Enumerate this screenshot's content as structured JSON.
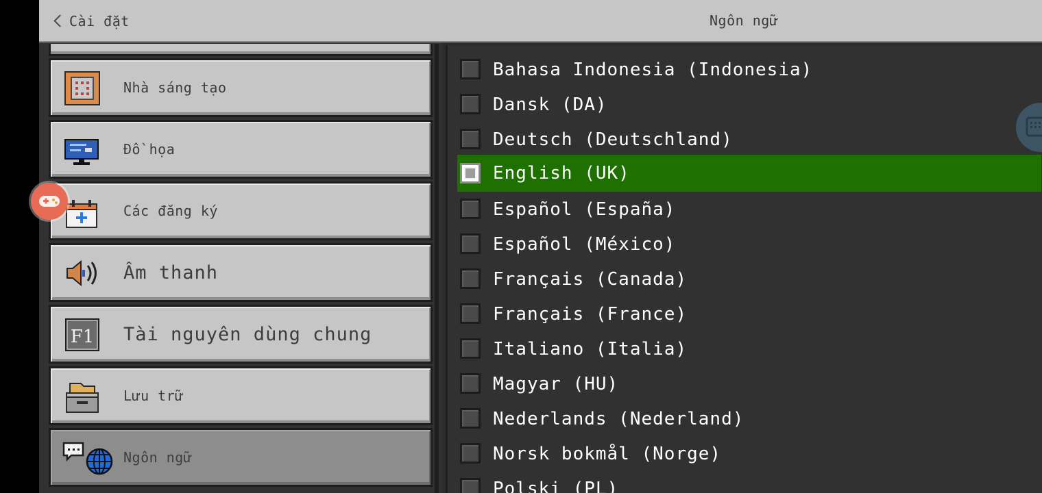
{
  "header": {
    "back_label": "Cài đặt",
    "title": "Ngôn ngữ"
  },
  "sidebar": {
    "items": [
      {
        "label": "Nhà sáng tạo",
        "icon": "command-block-icon"
      },
      {
        "label": "Đồ họa",
        "icon": "monitor-icon"
      },
      {
        "label": "Các đăng ký",
        "icon": "calendar-plus-icon"
      },
      {
        "label": "Âm thanh",
        "icon": "speaker-icon"
      },
      {
        "label": "Tài nguyên dùng chung",
        "icon": "f1-key-icon"
      },
      {
        "label": "Lưu trữ",
        "icon": "storage-box-icon"
      },
      {
        "label": "Ngôn ngữ",
        "icon": "chat-globe-icon"
      }
    ],
    "selected": "Ngôn ngữ"
  },
  "languages": {
    "items": [
      "Bahasa Indonesia (Indonesia)",
      "Dansk (DA)",
      "Deutsch (Deutschland)",
      "English (UK)",
      "Español (España)",
      "Español (México)",
      "Français (Canada)",
      "Français (France)",
      "Italiano (Italia)",
      "Magyar (HU)",
      "Nederlands (Nederland)",
      "Norsk bokmål (Norge)",
      "Polski (PL)"
    ],
    "selected": "English (UK)"
  },
  "colors": {
    "selected_row": "#1e7000",
    "panel_bg": "#313131",
    "tab_bg": "#c6c6c6"
  }
}
